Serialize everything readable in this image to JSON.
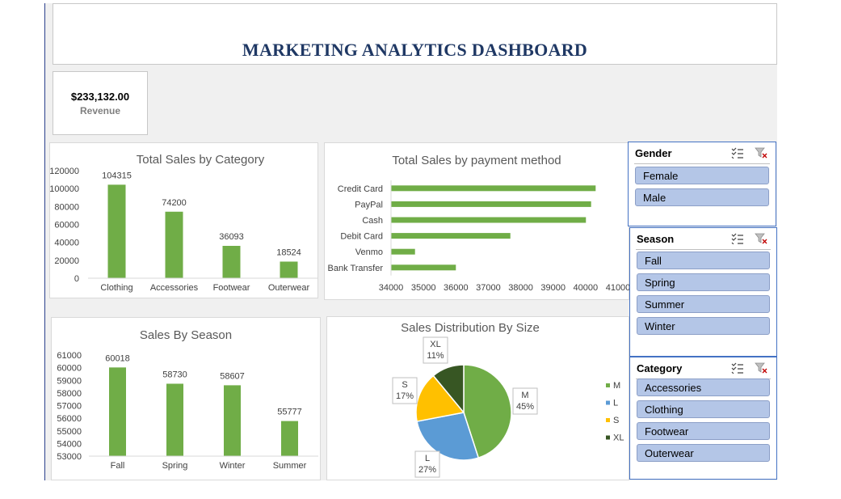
{
  "dashboard": {
    "title": "MARKETING ANALYTICS DASHBOARD",
    "kpi": {
      "value": "$233,132.00",
      "label": "Revenue"
    }
  },
  "slicers": {
    "gender": {
      "title": "Gender",
      "items": [
        "Female",
        "Male"
      ]
    },
    "season": {
      "title": "Season",
      "items": [
        "Fall",
        "Spring",
        "Summer",
        "Winter"
      ]
    },
    "category": {
      "title": "Category",
      "items": [
        "Accessories",
        "Clothing",
        "Footwear",
        "Outerwear"
      ]
    }
  },
  "colors": {
    "bar": "#70ad47",
    "M": "#70ad47",
    "L": "#5b9bd5",
    "S": "#ffc000",
    "XL": "#375623",
    "title": "#1f3864",
    "slicer_item": "#b4c6e7"
  },
  "icons": [
    "multi-select-icon",
    "clear-filter-icon"
  ],
  "chart_data": [
    {
      "type": "bar",
      "title": "Total Sales by Category",
      "categories": [
        "Clothing",
        "Accessories",
        "Footwear",
        "Outerwear"
      ],
      "values": [
        104315,
        74200,
        36093,
        18524
      ],
      "ylim": [
        0,
        120000
      ],
      "yticks": [
        0,
        20000,
        40000,
        60000,
        80000,
        100000,
        120000
      ]
    },
    {
      "type": "bar",
      "orientation": "horizontal",
      "title": "Total Sales by payment method",
      "categories": [
        "Credit Card",
        "PayPal",
        "Cash",
        "Debit Card",
        "Venmo",
        "Bank Transfer"
      ],
      "values": [
        40310,
        40170,
        40010,
        37680,
        34740,
        36000
      ],
      "xlim": [
        34000,
        41000
      ],
      "xticks": [
        34000,
        35000,
        36000,
        37000,
        38000,
        39000,
        40000,
        41000
      ]
    },
    {
      "type": "bar",
      "title": "Sales By Season",
      "categories": [
        "Fall",
        "Spring",
        "Winter",
        "Summer"
      ],
      "values": [
        60018,
        58730,
        58607,
        55777
      ],
      "ylim": [
        53000,
        61000
      ],
      "yticks": [
        53000,
        54000,
        55000,
        56000,
        57000,
        58000,
        59000,
        60000,
        61000
      ]
    },
    {
      "type": "pie",
      "title": "Sales Distribution By Size",
      "slices": [
        {
          "label": "M",
          "value": 45,
          "pct": "45%"
        },
        {
          "label": "L",
          "value": 27,
          "pct": "27%"
        },
        {
          "label": "S",
          "value": 17,
          "pct": "17%"
        },
        {
          "label": "XL",
          "value": 11,
          "pct": "11%"
        }
      ],
      "legend": [
        "M",
        "L",
        "S",
        "XL"
      ],
      "legend_position": "right"
    }
  ]
}
